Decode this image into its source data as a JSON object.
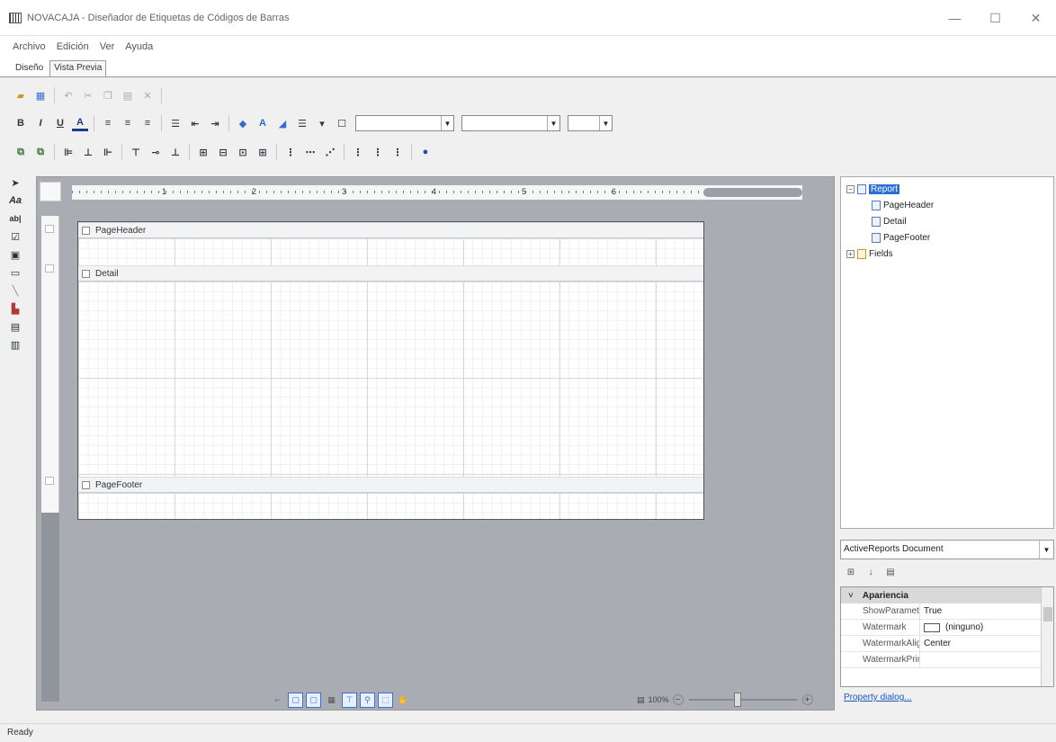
{
  "window": {
    "title": "NOVACAJA - Diseñador de Etiquetas de Códigos de Barras",
    "controls": {
      "minimize": "—",
      "maximize": "☐",
      "close": "✕"
    }
  },
  "menu": {
    "items": [
      "Archivo",
      "Edición",
      "Ver",
      "Ayuda"
    ]
  },
  "tabs": {
    "design": "Diseño",
    "preview": "Vista Previa"
  },
  "toolbar1": {
    "icons": [
      "open-folder-icon",
      "save-icon",
      "undo-icon",
      "cut-icon",
      "copy-icon",
      "paste-icon",
      "delete-icon"
    ]
  },
  "toolbar2": {
    "bold": "B",
    "italic": "I",
    "underline": "U",
    "font_color": "A",
    "font_size_up": "A",
    "font_name": "",
    "font_size": "",
    "style": ""
  },
  "toolbox": {
    "pointer": "➤",
    "label": "Aa",
    "textbox": "ab|"
  },
  "ruler": {
    "numbers": [
      "1",
      "2",
      "3",
      "4",
      "5",
      "6"
    ]
  },
  "sections": {
    "page_header": "PageHeader",
    "detail": "Detail",
    "page_footer": "PageFooter"
  },
  "tree": {
    "root": "Report",
    "children": [
      "PageHeader",
      "Detail",
      "PageFooter"
    ],
    "fields": "Fields",
    "expand_symbol": "−",
    "collapse_symbol": "+"
  },
  "properties": {
    "object_selector": "ActiveReports Document",
    "category": "Apariencia",
    "rows": [
      {
        "name": "ShowParamete",
        "value": "True"
      },
      {
        "name": "Watermark",
        "value": "(ninguno)"
      },
      {
        "name": "WatermarkAlig",
        "value": "Center"
      },
      {
        "name": "WatermarkPrin",
        "value": ""
      }
    ],
    "dialog_link": "Property dialog..."
  },
  "zoom": {
    "label": "100%"
  },
  "status": {
    "text": "Ready"
  },
  "colors": {
    "selection": "#2b6fd6",
    "canvas": "#a9adb3"
  }
}
